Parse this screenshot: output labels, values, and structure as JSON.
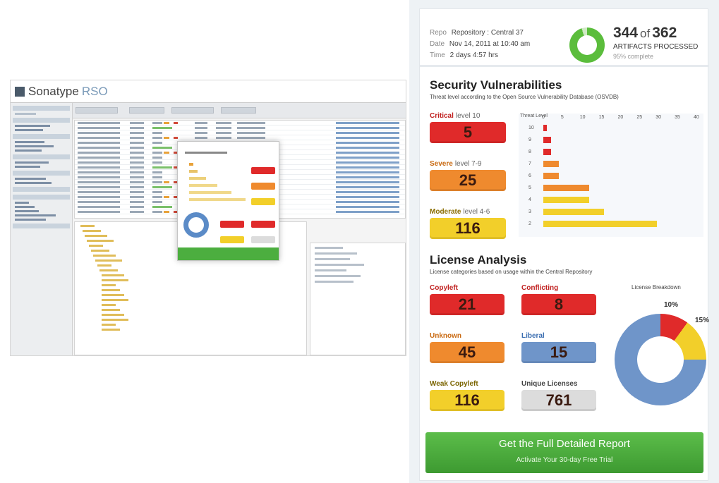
{
  "app": {
    "brand": "Sonatype",
    "product": "RSO"
  },
  "report": {
    "meta": [
      {
        "key": "Repo",
        "value": "Repository : Central 37"
      },
      {
        "key": "Date",
        "value": "Nov 14, 2011 at 10:40 am"
      },
      {
        "key": "Time",
        "value": "2 days 4:57 hrs"
      }
    ],
    "count": {
      "scanned": "344",
      "of_label": "of",
      "total": "362",
      "caption": "ARTIFACTS PROCESSED",
      "sub": "95% complete",
      "progress_fraction": 0.95
    },
    "security": {
      "title": "Security Vulnerabilities",
      "subtitle": "Threat level according to the Open Source Vulnerability Database (OSVDB)",
      "metrics": [
        {
          "label": "Critical",
          "sublabel": "level 10",
          "value": "5",
          "color": "#e02a2a"
        },
        {
          "label": "Severe",
          "sublabel": "level 7-9",
          "value": "25",
          "color": "#ef8a2e"
        },
        {
          "label": "Moderate",
          "sublabel": "level 4-6",
          "value": "116",
          "color": "#f2cf2a"
        }
      ]
    },
    "license": {
      "title": "License Analysis",
      "subtitle": "License categories based on usage within the Central Repository",
      "metrics": [
        {
          "label": "Copyleft",
          "value": "21",
          "color": "#e02a2a"
        },
        {
          "label": "Conflicting",
          "value": "8",
          "color": "#e02a2a"
        },
        {
          "label": "Unknown",
          "value": "45",
          "color": "#ef8a2e"
        },
        {
          "label": "Liberal",
          "value": "15",
          "color": "#6f95c9"
        },
        {
          "label": "Weak Copyleft",
          "value": "116",
          "color": "#f2cf2a"
        },
        {
          "label": "Unique Licenses",
          "value": "761",
          "color": "#dcdcdc"
        }
      ],
      "donut_title": "License Breakdown",
      "donut_labels": [
        "10%",
        "15%"
      ]
    },
    "cta": {
      "title": "Get the Full Detailed Report",
      "subtitle": "Activate Your 30-day Free Trial"
    }
  },
  "colors": {
    "critical": "#e02a2a",
    "severe": "#ef8a2e",
    "moderate": "#f2cf2a",
    "liberal": "#6f95c9",
    "cta_green": "#4cae3f",
    "ring_green": "#5bbd3c"
  },
  "chart_data": [
    {
      "type": "bar",
      "orientation": "horizontal",
      "title": "Security Vulnerabilities",
      "y_header": "Threat Level",
      "x_ticks": [
        "0",
        "5",
        "10",
        "15",
        "20",
        "25",
        "30",
        "35",
        "40"
      ],
      "categories": [
        "10",
        "9",
        "8",
        "7",
        "6",
        "5",
        "4",
        "3",
        "2"
      ],
      "values": [
        1,
        2,
        2,
        4,
        4,
        12,
        12,
        16,
        30
      ],
      "colors": [
        "#e02a2a",
        "#e02a2a",
        "#e02a2a",
        "#ef8a2e",
        "#ef8a2e",
        "#ef8a2e",
        "#f2cf2a",
        "#f2cf2a",
        "#f2cf2a"
      ],
      "xlim": [
        0,
        40
      ]
    },
    {
      "type": "pie",
      "title": "License Breakdown",
      "slices": [
        {
          "label": "10%",
          "value": 10,
          "color": "#e02a2a"
        },
        {
          "label": "15%",
          "value": 15,
          "color": "#f2cf2a"
        },
        {
          "label": "",
          "value": 75,
          "color": "#6f95c9"
        }
      ]
    }
  ]
}
